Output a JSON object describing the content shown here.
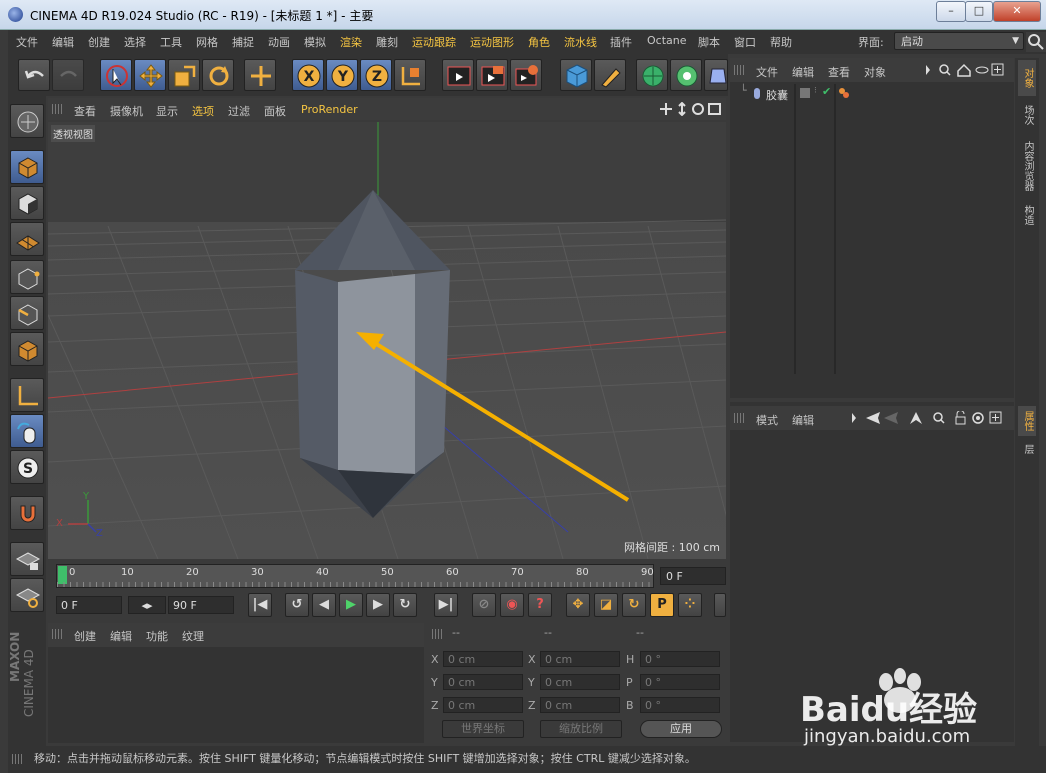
{
  "window": {
    "title": "CINEMA 4D R19.024 Studio (RC - R19) - [未标题 1 *] - 主要",
    "controls": {
      "minimize": "–",
      "maximize": "□",
      "close": "✕"
    }
  },
  "menubar": {
    "items": [
      "文件",
      "编辑",
      "创建",
      "选择",
      "工具",
      "网格",
      "捕捉",
      "动画",
      "模拟",
      "渲染",
      "雕刻",
      "运动跟踪",
      "运动图形",
      "角色",
      "流水线",
      "插件",
      "Octane",
      "脚本",
      "窗口",
      "帮助"
    ],
    "interface_label": "界面:",
    "interface_value": "启动"
  },
  "viewport": {
    "menu": [
      "查看",
      "摄像机",
      "显示",
      "选项",
      "过滤",
      "面板",
      "ProRender"
    ],
    "label": "透视视图",
    "grid_info": "网格间距 : 100 cm",
    "axis_labels": {
      "x": "X",
      "y": "Y",
      "z": "Z"
    }
  },
  "timeline": {
    "ticks": [
      "0",
      "10",
      "20",
      "30",
      "40",
      "50",
      "60",
      "70",
      "80",
      "90"
    ],
    "current_frame": "0 F"
  },
  "transport": {
    "start": "0 F",
    "end": "90 F"
  },
  "material_panel": {
    "menu": [
      "创建",
      "编辑",
      "功能",
      "纹理"
    ]
  },
  "coordinates": {
    "headers": [
      "--",
      "--",
      "--"
    ],
    "rows": [
      {
        "l1": "X",
        "v1": "0 cm",
        "l2": "X",
        "v2": "0 cm",
        "l3": "H",
        "v3": "0 °"
      },
      {
        "l1": "Y",
        "v1": "0 cm",
        "l2": "Y",
        "v2": "0 cm",
        "l3": "P",
        "v3": "0 °"
      },
      {
        "l1": "Z",
        "v1": "0 cm",
        "l2": "Z",
        "v2": "0 cm",
        "l3": "B",
        "v3": "0 °"
      }
    ],
    "world_coord": "世界坐标",
    "scale": "缩放比例",
    "apply": "应用"
  },
  "object_manager": {
    "menu": [
      "文件",
      "编辑",
      "查看",
      "对象"
    ],
    "objects": [
      {
        "name": "胶囊"
      }
    ]
  },
  "attribute_manager": {
    "menu": [
      "模式",
      "编辑"
    ]
  },
  "right_tabs": {
    "top": [
      "对象",
      "场次",
      "内容浏览器",
      "构造"
    ],
    "bottom": [
      "属性",
      "层"
    ]
  },
  "status": "移动：点击并拖动鼠标移动元素。按住 SHIFT 键量化移动；节点编辑模式时按住 SHIFT 键增加选择对象；按住 CTRL 键减少选择对象。",
  "branding": {
    "maxon": "MAXON",
    "cinema": "CINEMA 4D"
  },
  "watermark": {
    "brand": "Baidu经验",
    "url": "jingyan.baidu.com"
  },
  "colors": {
    "accent": "#f0b040",
    "highlight_menu": "#f5c542",
    "selected": "#5577aa",
    "arrow": "#f5b000"
  }
}
